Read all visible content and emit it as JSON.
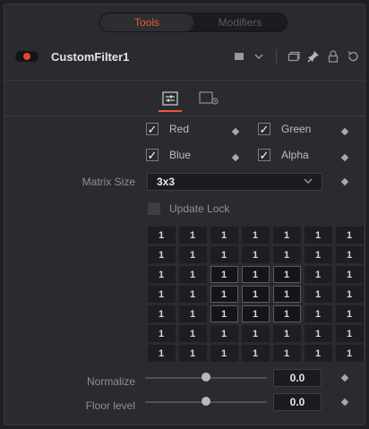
{
  "tabs": [
    {
      "label": "Tools",
      "active": true
    },
    {
      "label": "Modifiers",
      "active": false
    }
  ],
  "tool": {
    "name": "CustomFilter1",
    "enabled": true
  },
  "header_icons": [
    "color-swatch-icon",
    "chevron-down-icon",
    "window-icon",
    "pin-icon",
    "lock-icon",
    "reset-icon"
  ],
  "subtabs": [
    {
      "icon": "controls-icon",
      "active": true
    },
    {
      "icon": "settings-icon",
      "active": false
    }
  ],
  "channels": {
    "red": {
      "label": "Red",
      "checked": true
    },
    "green": {
      "label": "Green",
      "checked": true
    },
    "blue": {
      "label": "Blue",
      "checked": true
    },
    "alpha": {
      "label": "Alpha",
      "checked": true
    }
  },
  "matrix_size": {
    "label": "Matrix Size",
    "value": "3x3"
  },
  "update_lock": {
    "label": "Update Lock",
    "checked": false
  },
  "matrix": [
    [
      "1",
      "1",
      "1",
      "1",
      "1",
      "1",
      "1"
    ],
    [
      "1",
      "1",
      "1",
      "1",
      "1",
      "1",
      "1"
    ],
    [
      "1",
      "1",
      "1",
      "1",
      "1",
      "1",
      "1"
    ],
    [
      "1",
      "1",
      "1",
      "1",
      "1",
      "1",
      "1"
    ],
    [
      "1",
      "1",
      "1",
      "1",
      "1",
      "1",
      "1"
    ],
    [
      "1",
      "1",
      "1",
      "1",
      "1",
      "1",
      "1"
    ],
    [
      "1",
      "1",
      "1",
      "1",
      "1",
      "1",
      "1"
    ]
  ],
  "normalize": {
    "label": "Normalize",
    "value": "0.0",
    "level": 0.5
  },
  "floor_level": {
    "label": "Floor level",
    "value": "0.0",
    "level": 0.5
  },
  "colors": {
    "accent": "#e8583b",
    "record": "#e8452f",
    "panel": "#2a2b2e",
    "field": "#1b1c1f"
  }
}
